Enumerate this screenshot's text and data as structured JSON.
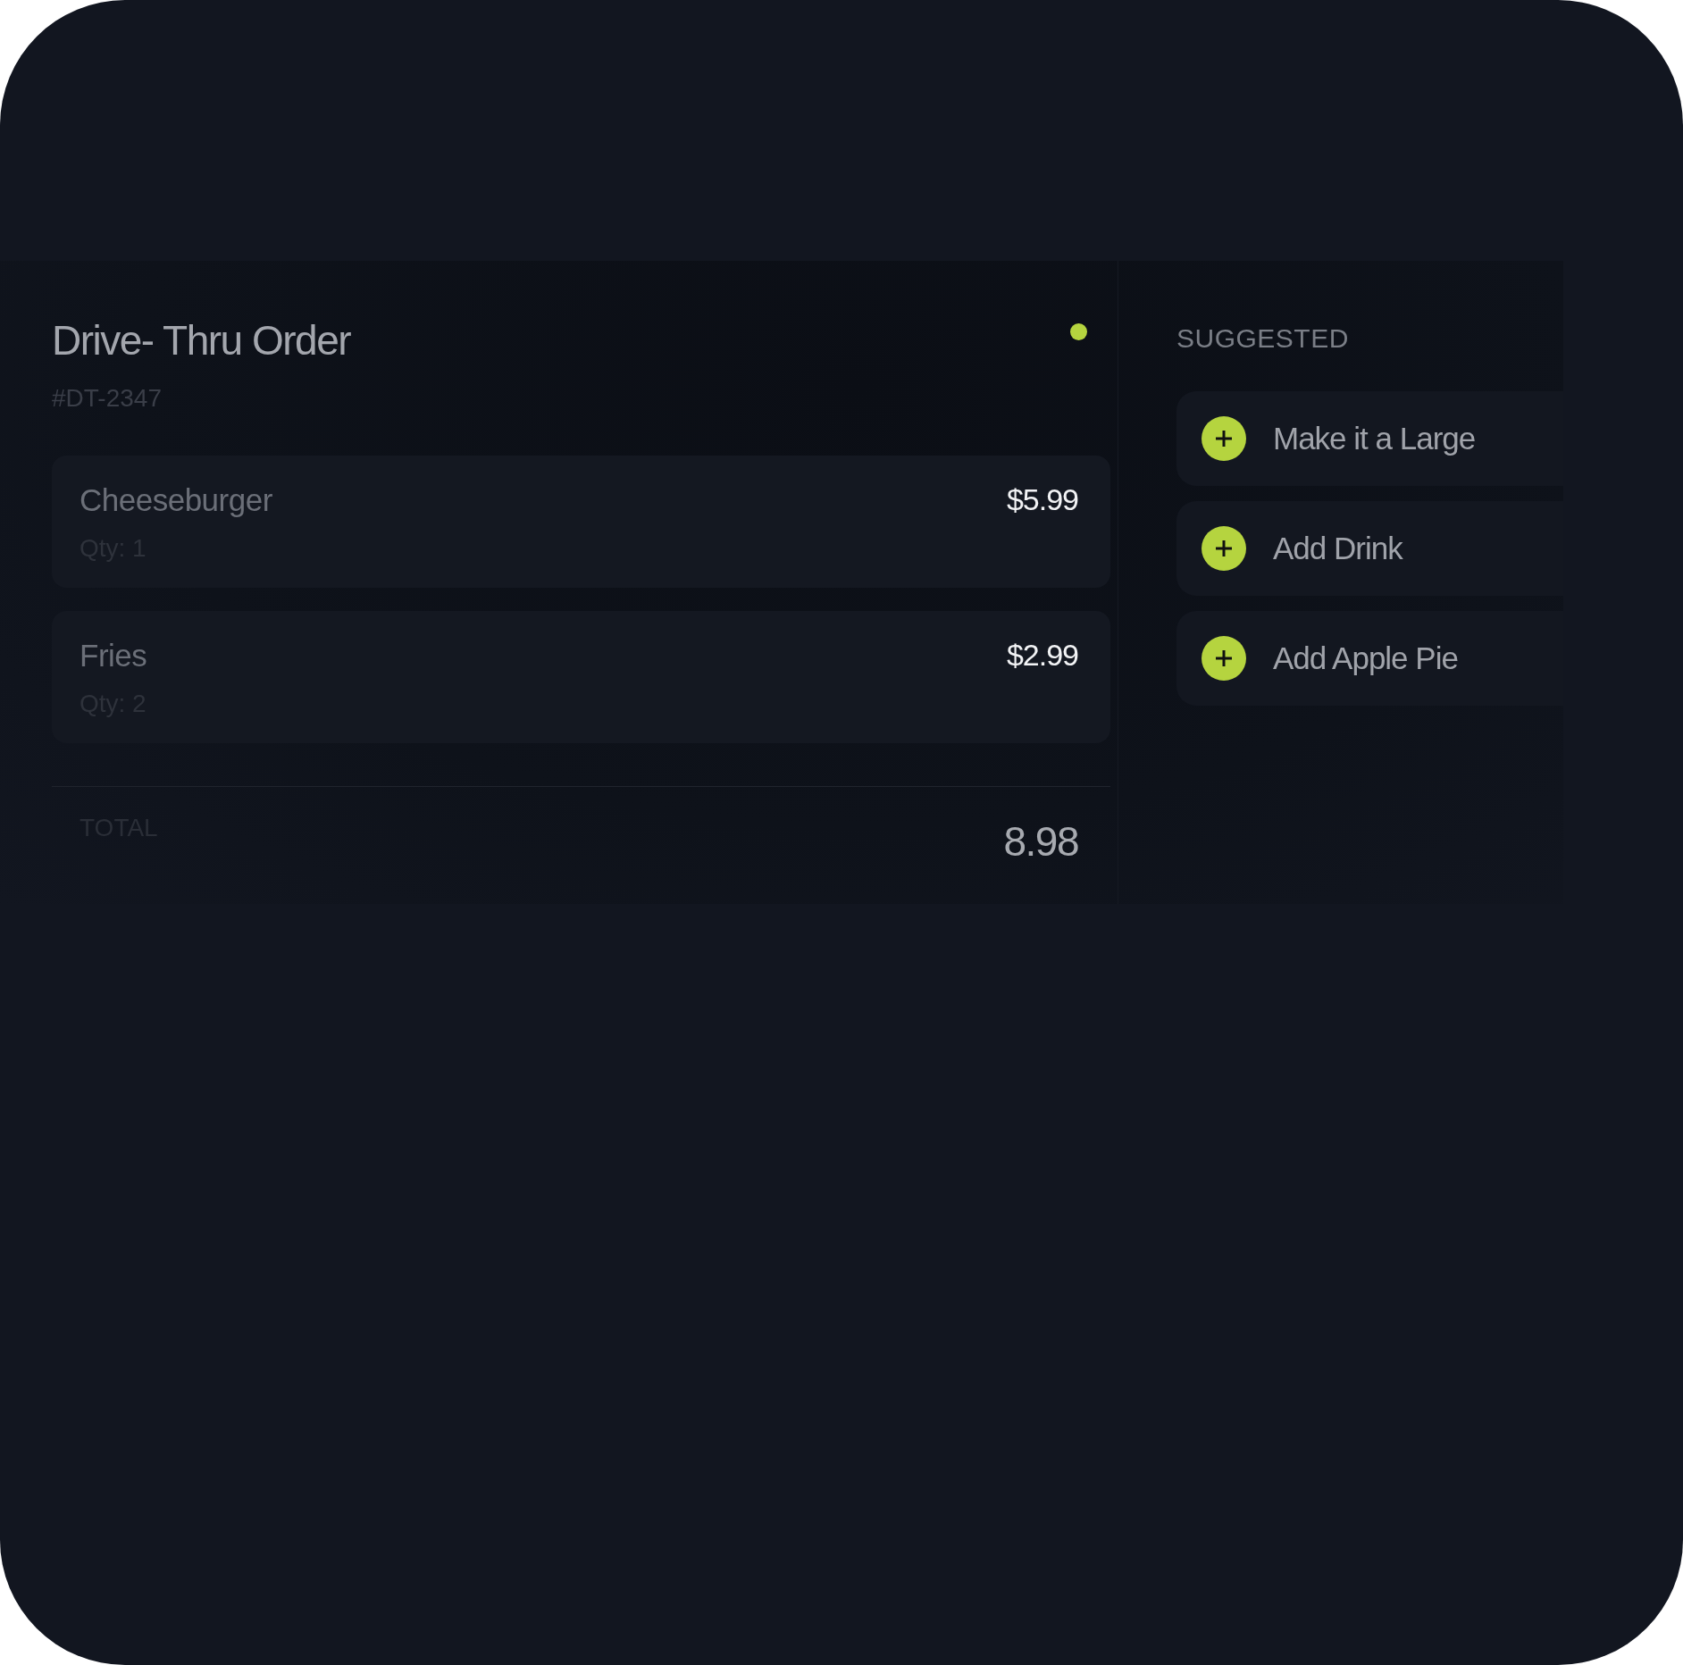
{
  "order": {
    "title": "Drive- Thru Order",
    "order_id": "#DT-2347",
    "items": [
      {
        "name": "Cheeseburger",
        "qty": "Qty: 1",
        "price": "$5.99"
      },
      {
        "name": "Fries",
        "qty": "Qty: 2",
        "price": "$2.99"
      }
    ],
    "total": {
      "label": "TOTAL",
      "value": "8.98"
    }
  },
  "suggested": {
    "heading": "SUGGESTED",
    "items": [
      {
        "label": "Make it a Large"
      },
      {
        "label": "Add Drink"
      },
      {
        "label": "Add Apple Pie"
      }
    ]
  }
}
